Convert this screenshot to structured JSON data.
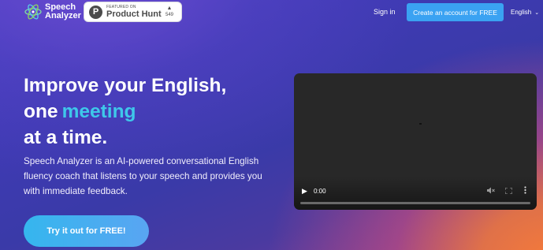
{
  "header": {
    "logo_text": "Speech Analyzer",
    "producthunt": {
      "featured": "FEATURED ON",
      "name": "Product Hunt",
      "votes": "549",
      "icon": "producthunt-p-icon",
      "letter": "P"
    },
    "signin_label": "Sign in",
    "create_account_label": "Create an account for FREE",
    "language": "English"
  },
  "hero": {
    "line1": "Improve your English,",
    "line2_prefix": "one",
    "line2_accent": "meeting",
    "line3": "at a time.",
    "description": "Speech Analyzer is an AI-powered conversational English fluency coach that listens to your speech and provides you with immediate feedback.",
    "try_button_label": "Try it out for FREE!"
  },
  "video": {
    "time": "0:00",
    "progress": 0
  },
  "colors": {
    "accent_text": "#3ec8ea",
    "button_blue": "#3aa2f2",
    "gradient_orange": "#f47a3a",
    "gradient_purple": "#3f3ab4"
  }
}
